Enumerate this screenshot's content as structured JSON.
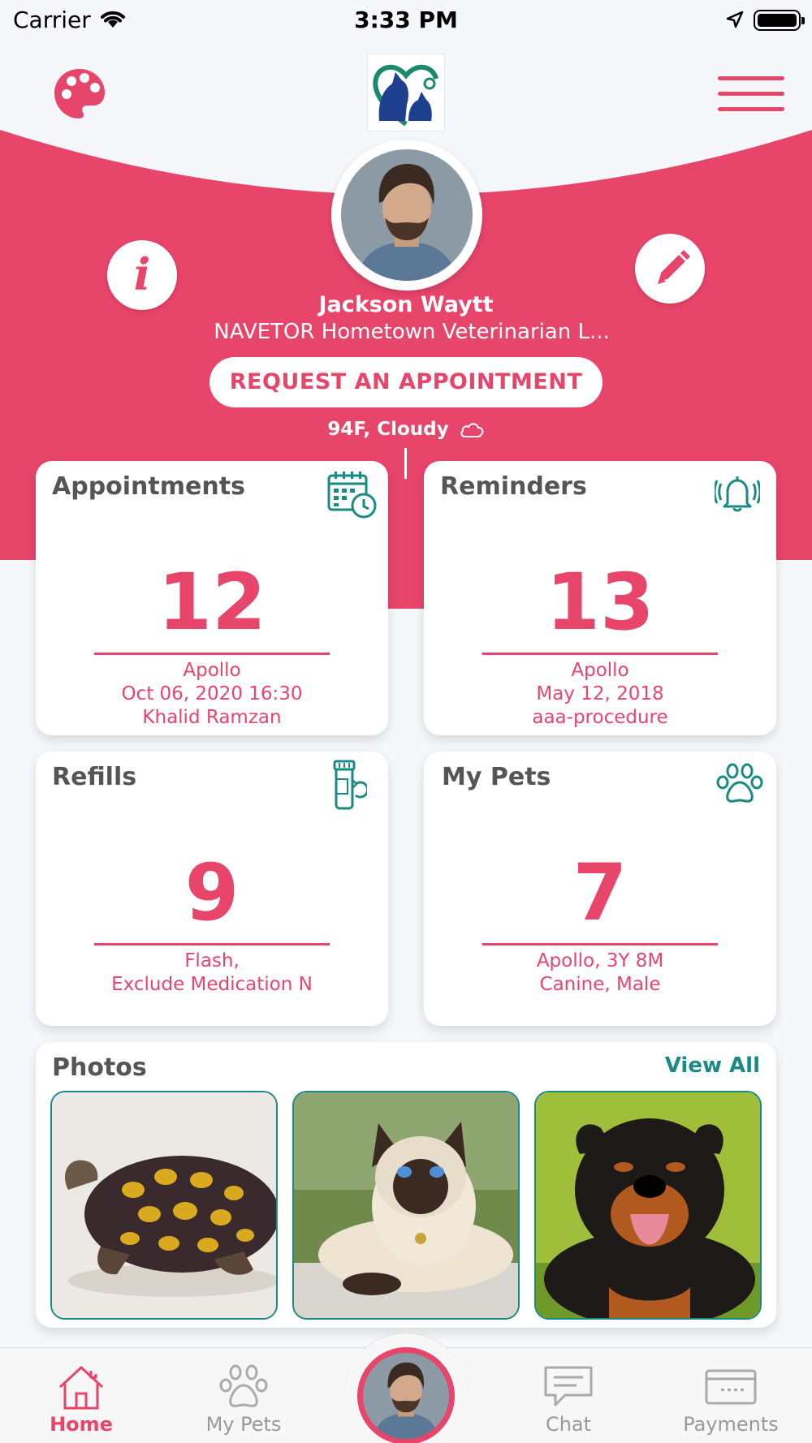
{
  "status_bar": {
    "carrier": "Carrier",
    "time": "3:33 PM"
  },
  "header": {
    "palette_icon": "palette-icon",
    "logo_icon": "clinic-logo",
    "menu_icon": "hamburger-menu-icon"
  },
  "profile": {
    "name": "Jackson Waytt",
    "clinic": "NAVETOR Hometown Veterinarian L...",
    "request_button": "REQUEST AN APPOINTMENT",
    "weather": "94F, Cloudy"
  },
  "colors": {
    "accent": "#e8456b",
    "teal": "#1a8a85",
    "background": "#f5f7fa"
  },
  "cards": {
    "appointments": {
      "title": "Appointments",
      "count": "12",
      "line1": "Apollo",
      "line2": "Oct 06, 2020 16:30",
      "line3": "Khalid Ramzan"
    },
    "reminders": {
      "title": "Reminders",
      "count": "13",
      "line1": "Apollo",
      "line2": "May 12, 2018",
      "line3": "aaa-procedure"
    },
    "refills": {
      "title": "Refills",
      "count": "9",
      "line1": "Flash,",
      "line2": "Exclude Medication N"
    },
    "my_pets": {
      "title": "My Pets",
      "count": "7",
      "line1": "Apollo, 3Y 8M",
      "line2": "Canine, Male"
    }
  },
  "photos": {
    "title": "Photos",
    "view_all": "View All"
  },
  "tabbar": {
    "home": "Home",
    "my_pets": "My Pets",
    "chat": "Chat",
    "payments": "Payments"
  }
}
